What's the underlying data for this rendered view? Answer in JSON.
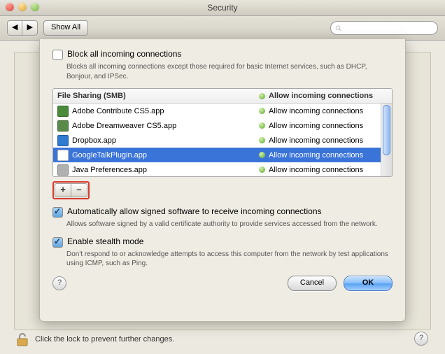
{
  "window": {
    "title": "Security"
  },
  "toolbar": {
    "back": "◀",
    "fwd": "▶",
    "show_all": "Show All",
    "search_placeholder": ""
  },
  "sheet": {
    "block_all": {
      "label": "Block all incoming connections",
      "desc": "Blocks all incoming connections except those required for basic Internet services, such as DHCP, Bonjour, and IPSec."
    },
    "list_header": {
      "name": "File Sharing (SMB)",
      "status": "Allow incoming connections"
    },
    "apps": [
      {
        "name": "Adobe Contribute CS5.app",
        "status": "Allow incoming connections",
        "icon": "#4a8a3a",
        "sel": false
      },
      {
        "name": "Adobe Dreamweaver CS5.app",
        "status": "Allow incoming connections",
        "icon": "#5a8a4a",
        "sel": false
      },
      {
        "name": "Dropbox.app",
        "status": "Allow incoming connections",
        "icon": "#2f7bd1",
        "sel": false
      },
      {
        "name": "GoogleTalkPlugin.app",
        "status": "Allow incoming connections",
        "icon": "#ffffff",
        "sel": true
      },
      {
        "name": "Java Preferences.app",
        "status": "Allow incoming connections",
        "icon": "#b0b0b0",
        "sel": false
      }
    ],
    "add": "+",
    "remove": "–",
    "auto_allow": {
      "label": "Automatically allow signed software to receive incoming connections",
      "desc": "Allows software signed by a valid certificate authority to provide services accessed from the network."
    },
    "stealth": {
      "label": "Enable stealth mode",
      "desc": "Don't respond to or acknowledge attempts to access this computer from the network by test applications using ICMP, such as Ping."
    },
    "help": "?",
    "cancel": "Cancel",
    "ok": "OK"
  },
  "footer": {
    "lock_text": "Click the lock to prevent further changes.",
    "help": "?"
  }
}
